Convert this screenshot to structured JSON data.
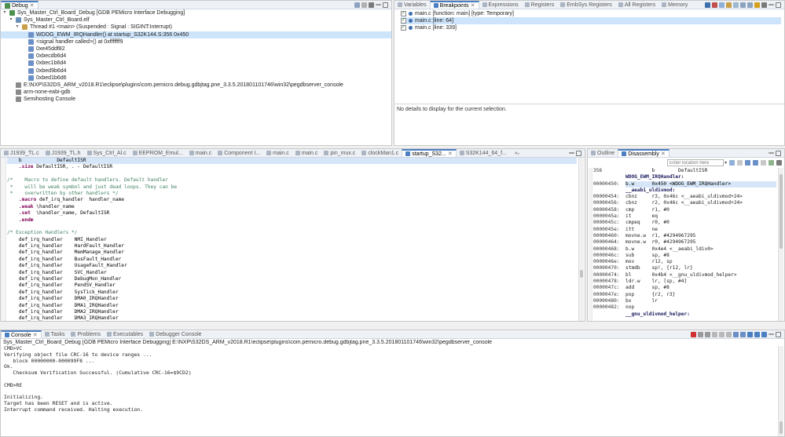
{
  "colors": {
    "accent": "#4a7fc1",
    "selection": "#cde4fa",
    "comment": "#3f7f5f",
    "keyword": "#7f0055",
    "thread_icon": "#c8a048",
    "frame_icon": "#6b8fc7",
    "check": "#2c7a2c"
  },
  "debug": {
    "tab": "Debug",
    "tree": [
      {
        "level": 0,
        "twisty": "v",
        "icon": "launch-icon",
        "text": "Sys_Master_Ctrl_Board_Debug [GDB PEMicro Interface Debugging]"
      },
      {
        "level": 1,
        "twisty": "v",
        "icon": "elf-icon",
        "text": "Sys_Master_Ctrl_Board.elf"
      },
      {
        "level": 2,
        "twisty": "v",
        "icon": "thread-icon",
        "text": "Thread #1 <main> (Suspended : Signal : SIGINT:Interrupt)"
      },
      {
        "level": 3,
        "twisty": "",
        "icon": "frame-icon",
        "text": "WDOG_EWM_IRQHandler() at startup_S32K144.S:356 0x450",
        "selected": true
      },
      {
        "level": 3,
        "twisty": "",
        "icon": "frame-icon",
        "text": "<signal handler called>() at 0xfffffff9"
      },
      {
        "level": 3,
        "twisty": "",
        "icon": "frame-icon",
        "text": "0xe45ddf82"
      },
      {
        "level": 3,
        "twisty": "",
        "icon": "frame-icon",
        "text": "0xbecdb6d4"
      },
      {
        "level": 3,
        "twisty": "",
        "icon": "frame-icon",
        "text": "0xbec1b6d4"
      },
      {
        "level": 3,
        "twisty": "",
        "icon": "frame-icon",
        "text": "0xbed9b6d4"
      },
      {
        "level": 3,
        "twisty": "",
        "icon": "frame-icon",
        "text": "0xbed1b6d6"
      },
      {
        "level": 1,
        "twisty": "",
        "icon": "process-icon",
        "text": "E:\\NXP\\S32DS_ARM_v2018.R1\\eclipse\\plugins\\com.pemicro.debug.gdbjtag.pne_3.3.5.201801101746\\win32\\pegdbserver_console"
      },
      {
        "level": 1,
        "twisty": "",
        "icon": "process-icon",
        "text": "arm-none-eabi-gdb"
      },
      {
        "level": 1,
        "twisty": "",
        "icon": "process-icon",
        "text": "Semihosting Console"
      }
    ]
  },
  "breakpoints": {
    "tabs": [
      "Variables",
      "Breakpoints",
      "Expressions",
      "Registers",
      "EmbSys Registers",
      "All Registers",
      "Memory"
    ],
    "active_tab": 1,
    "items": [
      {
        "text": "main.c [function: main] [type: Temporary]",
        "checked": true
      },
      {
        "text": "main.c [line: 64]",
        "checked": true,
        "selected": true
      },
      {
        "text": "main.c [line: 339]",
        "checked": true
      }
    ],
    "details": "No details to display for the current selection."
  },
  "editor": {
    "tabs": [
      "J1939_TL.c",
      "J1939_TL.h",
      "Sys_Ctrl_Al.c",
      "EEPROM_Emul...",
      "main.c",
      "Component I...",
      "main.c",
      "main.c",
      "pin_mux.c",
      "clockMan1.c",
      "startup_S32...",
      "S32K144_64_f..."
    ],
    "overflow": "»₇",
    "active_tab": 10,
    "lines": [
      {
        "parts": [
          {
            "c": "lab",
            "t": "    b            DefaultISR"
          }
        ],
        "highlight": true
      },
      {
        "parts": [
          {
            "c": "kw",
            "t": "    .size"
          },
          {
            "c": "lab",
            "t": " DefaultISR, . - DefaultISR"
          }
        ]
      },
      {
        "parts": [
          {
            "c": "lab",
            "t": ""
          }
        ]
      },
      {
        "parts": [
          {
            "c": "cm",
            "t": "/*    Macro to define default handlers. Default handler"
          }
        ]
      },
      {
        "parts": [
          {
            "c": "cm",
            "t": " *    will be weak symbol and just dead loops. They can be"
          }
        ]
      },
      {
        "parts": [
          {
            "c": "cm",
            "t": " *    overwritten by other handlers */"
          }
        ]
      },
      {
        "parts": [
          {
            "c": "kw",
            "t": "    .macro"
          },
          {
            "c": "lab",
            "t": " def_irq_handler  handler_name"
          }
        ]
      },
      {
        "parts": [
          {
            "c": "kw",
            "t": "    .weak"
          },
          {
            "c": "lab",
            "t": " \\handler_name"
          }
        ]
      },
      {
        "parts": [
          {
            "c": "kw",
            "t": "    .set"
          },
          {
            "c": "lab",
            "t": "  \\handler_name, DefaultISR"
          }
        ]
      },
      {
        "parts": [
          {
            "c": "kw",
            "t": "    .endm"
          }
        ]
      },
      {
        "parts": [
          {
            "c": "lab",
            "t": ""
          }
        ]
      },
      {
        "parts": [
          {
            "c": "cm",
            "t": "/* Exception Handlers */"
          }
        ]
      },
      {
        "parts": [
          {
            "c": "lab",
            "t": "    def_irq_handler    NMI_Handler"
          }
        ]
      },
      {
        "parts": [
          {
            "c": "lab",
            "t": "    def_irq_handler    HardFault_Handler"
          }
        ]
      },
      {
        "parts": [
          {
            "c": "lab",
            "t": "    def_irq_handler    MemManage_Handler"
          }
        ]
      },
      {
        "parts": [
          {
            "c": "lab",
            "t": "    def_irq_handler    BusFault_Handler"
          }
        ]
      },
      {
        "parts": [
          {
            "c": "lab",
            "t": "    def_irq_handler    UsageFault_Handler"
          }
        ]
      },
      {
        "parts": [
          {
            "c": "lab",
            "t": "    def_irq_handler    SVC_Handler"
          }
        ]
      },
      {
        "parts": [
          {
            "c": "lab",
            "t": "    def_irq_handler    DebugMon_Handler"
          }
        ]
      },
      {
        "parts": [
          {
            "c": "lab",
            "t": "    def_irq_handler    PendSV_Handler"
          }
        ]
      },
      {
        "parts": [
          {
            "c": "lab",
            "t": "    def_irq_handler    SysTick_Handler"
          }
        ]
      },
      {
        "parts": [
          {
            "c": "lab",
            "t": "    def_irq_handler    DMA0_IRQHandler"
          }
        ]
      },
      {
        "parts": [
          {
            "c": "lab",
            "t": "    def_irq_handler    DMA1_IRQHandler"
          }
        ]
      },
      {
        "parts": [
          {
            "c": "lab",
            "t": "    def_irq_handler    DMA2_IRQHandler"
          }
        ]
      },
      {
        "parts": [
          {
            "c": "lab",
            "t": "    def_irq_handler    DMA3_IRQHandler"
          }
        ]
      }
    ]
  },
  "disassembly": {
    "tabs": [
      "Outline",
      "Disassembly"
    ],
    "active_tab": 1,
    "location_placeholder": "Enter location here",
    "rows": [
      {
        "addr": "356",
        "code": "         b        DefaultISR"
      },
      {
        "addr": "",
        "code": "WDOG_EWM_IRQHandler:",
        "bold": true
      },
      {
        "addr": "00000450:",
        "code": "b.w      0x450 <WDOG_EWM_IRQHandler>",
        "current": true
      },
      {
        "addr": "",
        "code": "__aeabi_uldivmod:",
        "bold": true
      },
      {
        "addr": "00000454:",
        "code": "cbnz     r3, 0x46c <__aeabi_uldivmod+24>"
      },
      {
        "addr": "00000456:",
        "code": "cbnz     r2, 0x46c <__aeabi_uldivmod+24>"
      },
      {
        "addr": "00000458:",
        "code": "cmp      r1, #0"
      },
      {
        "addr": "0000045a:",
        "code": "it       eq"
      },
      {
        "addr": "0000045c:",
        "code": "cmpeq    r0, #0"
      },
      {
        "addr": "0000045e:",
        "code": "itt      ne"
      },
      {
        "addr": "00000460:",
        "code": "movne.w  r1, #4294967295"
      },
      {
        "addr": "00000464:",
        "code": "movne.w  r0, #4294967295"
      },
      {
        "addr": "00000468:",
        "code": "b.w      0x4e4 <__aeabi_ldiv0>"
      },
      {
        "addr": "0000046c:",
        "code": "sub      sp, #8"
      },
      {
        "addr": "0000046e:",
        "code": "mov      r12, sp"
      },
      {
        "addr": "00000470:",
        "code": "stmdb    sp!, {r12, lr}"
      },
      {
        "addr": "00000474:",
        "code": "bl       0x4b4 <__gnu_uldivmod_helper>"
      },
      {
        "addr": "00000478:",
        "code": "ldr.w    lr, [sp, #4]"
      },
      {
        "addr": "0000047c:",
        "code": "add      sp, #8"
      },
      {
        "addr": "0000047e:",
        "code": "pop      {r2, r3}"
      },
      {
        "addr": "00000480:",
        "code": "bx       lr"
      },
      {
        "addr": "00000482:",
        "code": "nop"
      },
      {
        "addr": "",
        "code": "__gnu_uldivmod_helper:",
        "bold": true
      }
    ]
  },
  "console": {
    "tabs": [
      "Console",
      "Tasks",
      "Problems",
      "Executables",
      "Debugger Console"
    ],
    "active_tab": 0,
    "title": "Sys_Master_Ctrl_Board_Debug [GDB PEMicro Interface Debugging] E:\\NXP\\S32DS_ARM_v2018.R1\\eclipse\\plugins\\com.pemicro.debug.gdbjtag.pne_3.3.5.201801101746\\win32\\pegdbserver_console",
    "lines": [
      "CMD>VC",
      "Verifying object file CRC-16 to device ranges ...",
      "   block 00000000-000099F8 ...",
      "Ok.",
      "   Checksum Verification Successful. (Cumulative CRC-16=$9CD2)",
      "",
      "CMD>RE",
      "",
      "Initializing.",
      "Target has been RESET and is active.",
      "Interrupt command received. Halting execution."
    ]
  }
}
